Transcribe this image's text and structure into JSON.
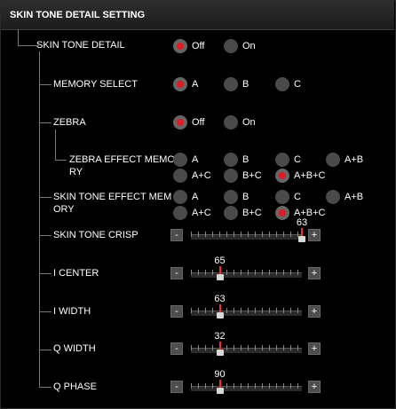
{
  "header": {
    "title": "SKIN TONE DETAIL SETTING"
  },
  "colors": {
    "selected": "#e01b24",
    "radio_bg": "#4a4a4a",
    "background": "#000000"
  },
  "rows": {
    "skin_tone_detail": {
      "label": "SKIN TONE DETAIL",
      "options": [
        "Off",
        "On"
      ],
      "selected": "Off"
    },
    "memory_select": {
      "label": "MEMORY SELECT",
      "options": [
        "A",
        "B",
        "C"
      ],
      "selected": "A"
    },
    "zebra": {
      "label": "ZEBRA",
      "options": [
        "Off",
        "On"
      ],
      "selected": "Off"
    },
    "zebra_effect_memory": {
      "label_line1": "ZEBRA EFFECT MEMO",
      "label_line2": "RY",
      "options": [
        "A",
        "B",
        "C",
        "A+B",
        "A+C",
        "B+C",
        "A+B+C"
      ],
      "selected": "A+B+C"
    },
    "skin_tone_effect_memory": {
      "label_line1": "SKIN TONE EFFECT MEM",
      "label_line2": "ORY",
      "options": [
        "A",
        "B",
        "C",
        "A+B",
        "A+C",
        "B+C",
        "A+B+C"
      ],
      "selected": "A+B+C"
    }
  },
  "sliders": {
    "minus_label": "-",
    "plus_label": "+",
    "skin_tone_crisp": {
      "label": "SKIN TONE CRISP",
      "value": "63",
      "position": 1.0
    },
    "i_center": {
      "label": "I CENTER",
      "value": "65",
      "position": 0.26
    },
    "i_width": {
      "label": "I WIDTH",
      "value": "63",
      "position": 0.26
    },
    "q_width": {
      "label": "Q WIDTH",
      "value": "32",
      "position": 0.26
    },
    "q_phase": {
      "label": "Q PHASE",
      "value": "90",
      "position": 0.26
    }
  }
}
